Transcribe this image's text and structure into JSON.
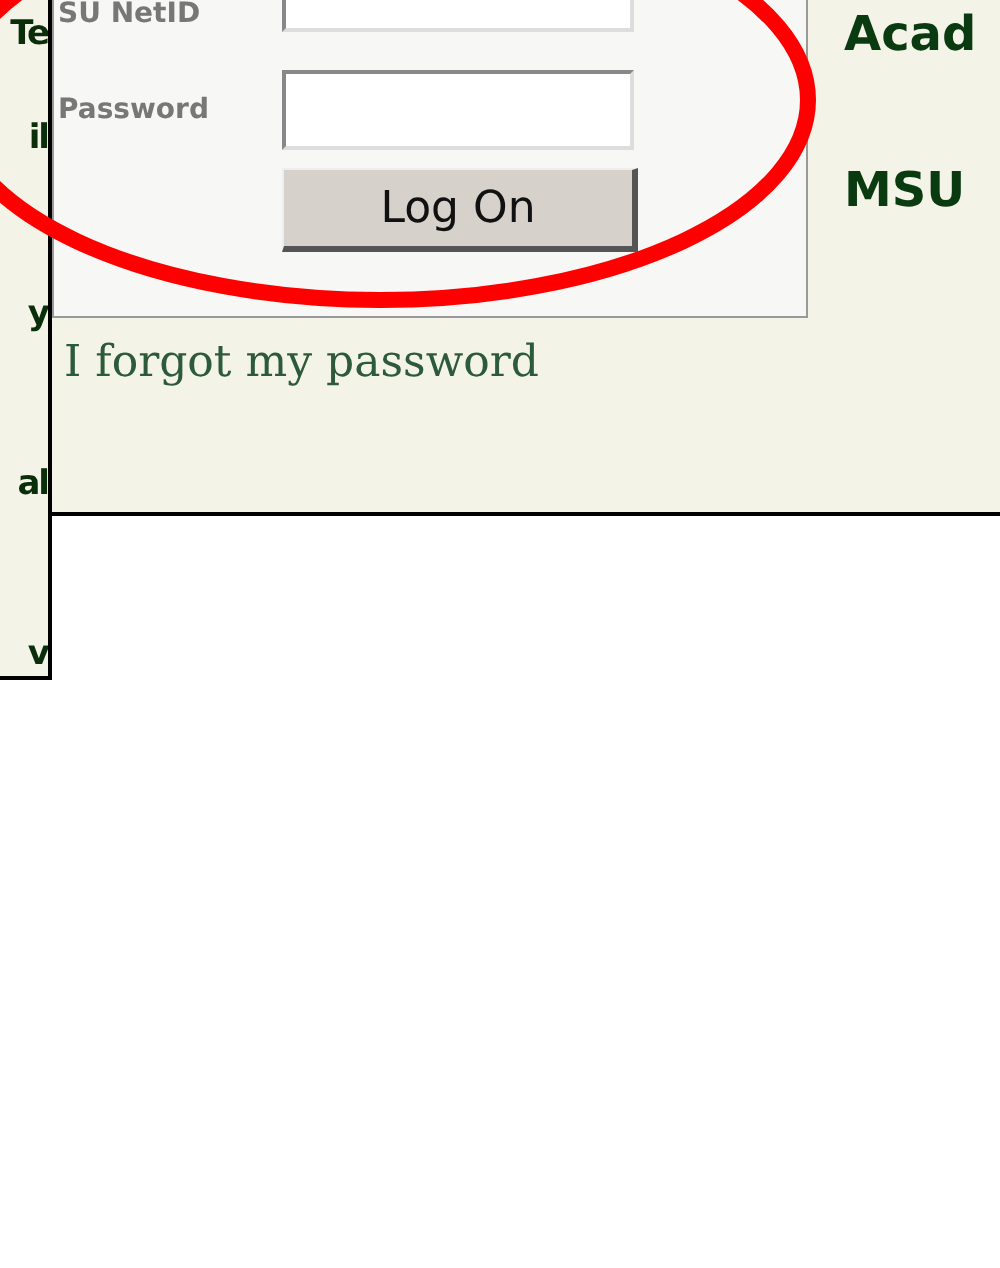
{
  "left_strip": {
    "fragments": [
      "Te",
      "il",
      "y",
      "al",
      "v"
    ]
  },
  "login": {
    "fields": [
      {
        "label": "SU NetID"
      },
      {
        "label": "Password"
      }
    ],
    "button": "Log On",
    "forgot_link": "I forgot my password"
  },
  "right_column": {
    "fragments": [
      "Acad",
      "MSU"
    ]
  },
  "annotation": {
    "kind": "ellipse"
  }
}
